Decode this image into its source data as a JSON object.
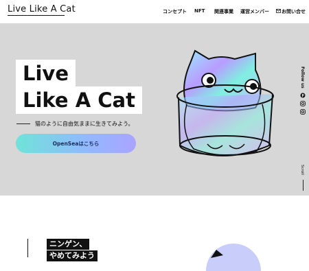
{
  "header": {
    "logo": "Live Like A Cat",
    "nav": [
      {
        "label": "コンセプト"
      },
      {
        "label": "NFT"
      },
      {
        "label": "関連事業"
      },
      {
        "label": "運営メンバー"
      },
      {
        "label": "お問い合せ",
        "icon": "mail-icon"
      }
    ]
  },
  "hero": {
    "title_line1": "Live",
    "title_line2": "Like A Cat",
    "tagline": "猫のように自由気ままに生きてみよう。",
    "cta_label": "OpenSeaはこちら",
    "cta_gradient": [
      "#6fe3d8",
      "#a9a4ff"
    ],
    "background": "#d7d7d7"
  },
  "side": {
    "follow_label": "Follow us",
    "social_icons": [
      "pinterest-icon",
      "instagram-icon",
      "instagram-icon"
    ],
    "scroll_label": "Scroll"
  },
  "section2": {
    "heading_line1": "ニンゲン、",
    "heading_line2": "やめてみよう"
  }
}
